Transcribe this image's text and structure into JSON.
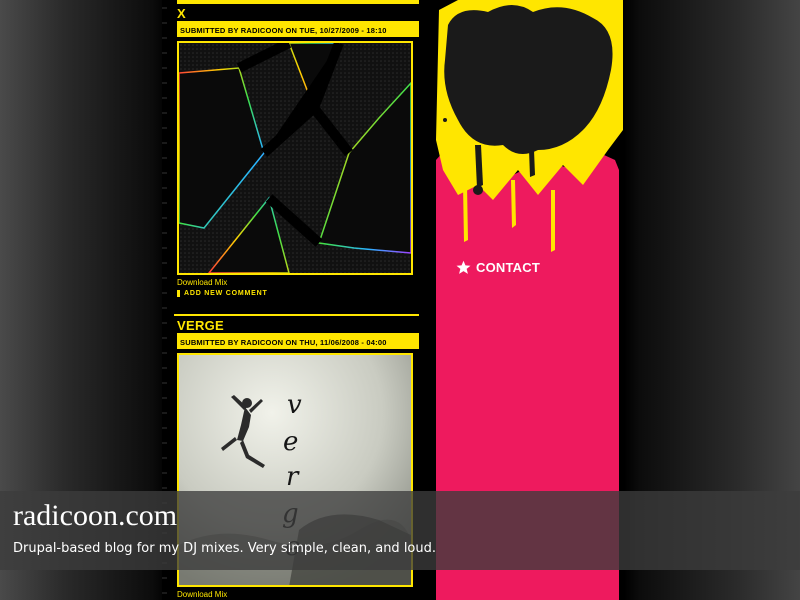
{
  "posts": [
    {
      "title": "X",
      "meta": "SUBMITTED BY RADICOON ON TUE, 10/27/2009 - 18:10",
      "artwork_text": "",
      "download_label": "Download Mix",
      "comment_label": "ADD NEW COMMENT"
    },
    {
      "title": "VERGE",
      "meta": "SUBMITTED BY RADICOON ON THU, 11/06/2008 - 04:00",
      "artwork_text": "verge",
      "download_label": "Download Mix"
    }
  ],
  "sidebar": {
    "contact_label": "CONTACT"
  },
  "caption": {
    "title": "radicoon.com",
    "description": "Drupal-based blog for my DJ mixes. Very simple, clean, and loud."
  },
  "colors": {
    "accent_yellow": "#ffe600",
    "accent_pink": "#ee1a5e",
    "background": "#000000"
  }
}
